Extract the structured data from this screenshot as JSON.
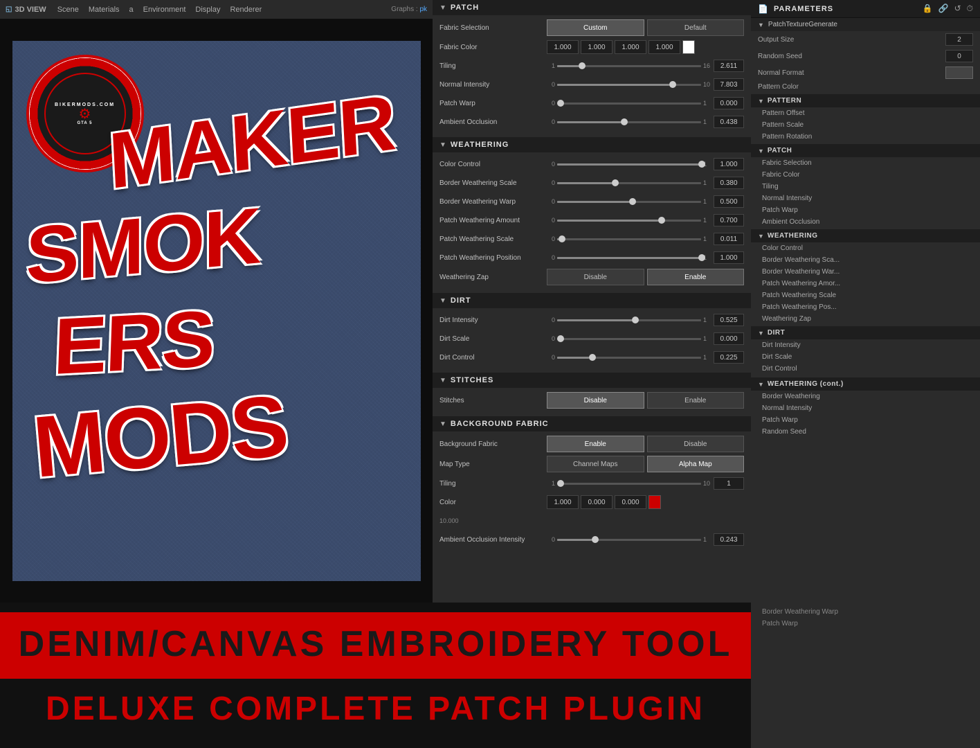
{
  "viewport": {
    "title": "3D VIEW",
    "nav": [
      "Scene",
      "Materials",
      "a",
      "Environment",
      "Display",
      "Renderer"
    ],
    "graphs_label": "Graphs :",
    "graphs_value": "pk"
  },
  "patch_panel": {
    "title": "PATCH",
    "sections": {
      "patch": {
        "label": "PATCH",
        "fabric_selection_label": "Fabric Selection",
        "fabric_custom": "Custom",
        "fabric_default": "Default",
        "fabric_color_label": "Fabric Color",
        "fabric_color_values": [
          "1.000",
          "1.000",
          "1.000",
          "1.000"
        ],
        "tiling_label": "Tiling",
        "tiling_min": "1",
        "tiling_max": "16",
        "tiling_value": "2.611",
        "normal_intensity_label": "Normal Intensity",
        "normal_min": "0",
        "normal_max": "10",
        "normal_value": "7.803",
        "patch_warp_label": "Patch Warp",
        "patch_warp_min": "0",
        "patch_warp_max": "1",
        "patch_warp_value": "0.000",
        "ambient_label": "Ambient Occlusion",
        "ambient_min": "0",
        "ambient_max": "1",
        "ambient_value": "0.438"
      },
      "weathering": {
        "label": "WEATHERING",
        "color_control_label": "Color Control",
        "color_min": "0",
        "color_max": "1",
        "color_value": "1.000",
        "border_scale_label": "Border Weathering Scale",
        "border_scale_min": "0",
        "border_scale_max": "1",
        "border_scale_value": "0.380",
        "border_warp_label": "Border Weathering Warp",
        "border_warp_min": "0",
        "border_warp_max": "1",
        "border_warp_value": "0.500",
        "patch_amount_label": "Patch Weathering Amount",
        "patch_amount_min": "0",
        "patch_amount_max": "1",
        "patch_amount_value": "0.700",
        "patch_scale_label": "Patch Weathering Scale",
        "patch_scale_min": "0",
        "patch_scale_max": "1",
        "patch_scale_value": "0.011",
        "patch_pos_label": "Patch Weathering Position",
        "patch_pos_min": "0",
        "patch_pos_max": "1",
        "patch_pos_value": "1.000",
        "zap_label": "Weathering Zap",
        "zap_disable": "Disable",
        "zap_enable": "Enable"
      },
      "dirt": {
        "label": "DIRT",
        "dirt_intensity_label": "Dirt Intensity",
        "dirt_int_min": "0",
        "dirt_int_max": "1",
        "dirt_int_value": "0.525",
        "dirt_scale_label": "Dirt Scale",
        "dirt_scale_min": "0",
        "dirt_scale_max": "1",
        "dirt_scale_value": "0.000",
        "dirt_control_label": "Dirt Control",
        "dirt_ctrl_min": "0",
        "dirt_ctrl_max": "1",
        "dirt_ctrl_value": "0.225"
      },
      "stitches": {
        "label": "STITCHES",
        "stitches_label": "Stitches",
        "disable": "Disable",
        "enable": "Enable"
      },
      "background": {
        "label": "BACKGROUND FABRIC",
        "bg_fabric_label": "Background Fabric",
        "bg_enable": "Enable",
        "bg_disable": "Disable",
        "map_type_label": "Map Type",
        "channel_maps": "Channel Maps",
        "alpha_map": "Alpha Map",
        "tiling_label": "Tiling",
        "tiling_min": "1",
        "tiling_max": "10",
        "tiling_value": "1",
        "color_label": "Color",
        "color_r": "1.000",
        "color_g": "0.000",
        "color_b": "0.000",
        "ambient_label": "Ambient Occlusion Intensity",
        "ambient_min": "0",
        "ambient_max": "1",
        "ambient_value": "0.243"
      }
    }
  },
  "params_panel": {
    "title": "PARAMETERS",
    "node_title": "PatchTextureGenerate",
    "top_params": [
      {
        "label": "Output Size",
        "value": "2"
      },
      {
        "label": "Random Seed",
        "value": "0"
      },
      {
        "label": "Normal Format",
        "value": ""
      },
      {
        "label": "Pattern Color",
        "value": ""
      }
    ],
    "sections": [
      {
        "label": "PATTERN",
        "items": [
          "Pattern Offset",
          "Pattern Scale",
          "Pattern Rotation"
        ]
      },
      {
        "label": "PATCH",
        "items": [
          "Fabric Selection",
          "Fabric Color",
          "Tiling",
          "Normal Intensity",
          "Patch Warp",
          "Ambient Occlusion"
        ]
      },
      {
        "label": "WEATHERING",
        "items": [
          "Color Control",
          "Border Weathering Sca...",
          "Border Weathering War...",
          "Patch Weathering Amor...",
          "Patch Weathering Scale",
          "Patch Weathering Pos...",
          "Weathering Zap"
        ]
      },
      {
        "label": "DIRT",
        "items": [
          "Dirt Intensity",
          "Dirt Scale",
          "Dirt Control"
        ]
      }
    ]
  },
  "banners": {
    "line1": "Denim/Canvas Embroidery Tool",
    "line2": "Deluxe Complete Patch Plugin"
  },
  "logo": {
    "text1": "BIKERMODS.COM",
    "text2": "GTA 5"
  }
}
